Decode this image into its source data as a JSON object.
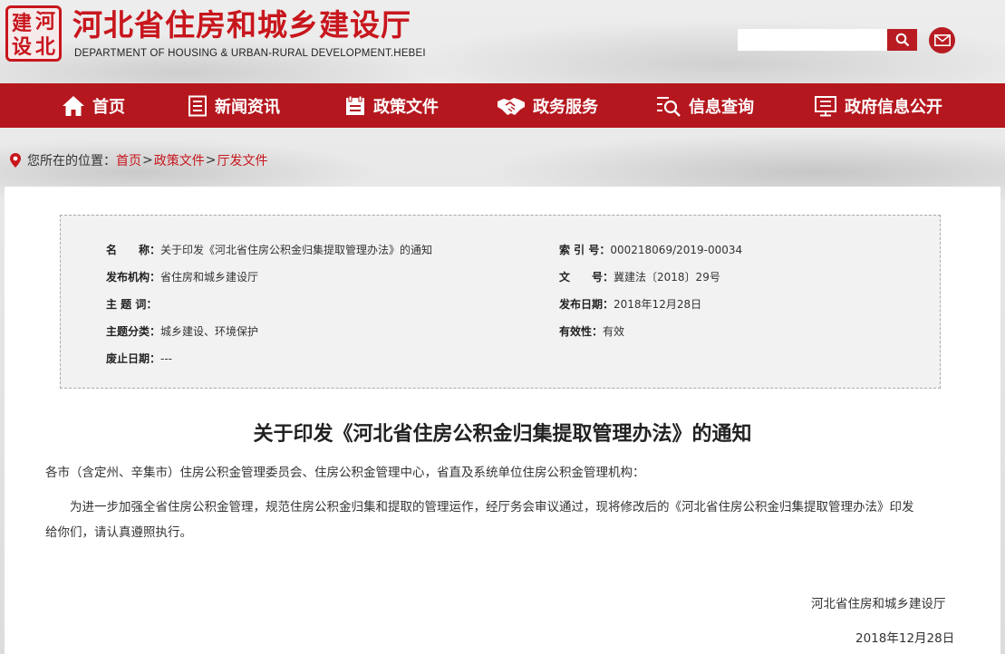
{
  "header": {
    "logo_text": "建河",
    "title": "河北省住房和城乡建设厅",
    "subtitle": "DEPARTMENT OF HOUSING & URBAN-RURAL DEVELOPMENT.HEBEI",
    "search_placeholder": "",
    "search_icon": "search-icon",
    "mail_icon": "mail-icon"
  },
  "nav": {
    "items": [
      {
        "label": "首页",
        "icon": "home-icon"
      },
      {
        "label": "新闻资讯",
        "icon": "news-icon"
      },
      {
        "label": "政策文件",
        "icon": "document-icon"
      },
      {
        "label": "政务服务",
        "icon": "handshake-icon"
      },
      {
        "label": "信息查询",
        "icon": "search-list-icon"
      },
      {
        "label": "政府信息公开",
        "icon": "disclosure-icon"
      }
    ]
  },
  "breadcrumb": {
    "prefix": "您所在的位置：",
    "items": [
      "首页",
      "政策文件",
      "厅发文件"
    ],
    "separator": ">"
  },
  "meta": {
    "name_label": "名　　称：",
    "name_value": "关于印发《河北省住房公积金归集提取管理办法》的通知",
    "index_label": "索 引 号：",
    "index_value": "000218069/2019-00034",
    "issuer_label": "发布机构：",
    "issuer_value": "省住房和城乡建设厅",
    "docno_label": "文　　号：",
    "docno_value": "冀建法〔2018〕29号",
    "keywords_label": "主 题 词：",
    "keywords_value": "",
    "date_label": "发布日期：",
    "date_value": "2018年12月28日",
    "category_label": "主题分类：",
    "category_value": "城乡建设、环境保护",
    "validity_label": "有效性：",
    "validity_value": "有效",
    "expiry_label": "废止日期：",
    "expiry_value": "---"
  },
  "document": {
    "title": "关于印发《河北省住房公积金归集提取管理办法》的通知",
    "addressee": "各市（含定州、辛集市）住房公积金管理委员会、住房公积金管理中心，省直及系统单位住房公积金管理机构：",
    "body_line1": "为进一步加强全省住房公积金管理，规范住房公积金归集和提取的管理运作，经厅务会审议通过，现将修改后的《河北省住房公积金归集提取管理办法》印发",
    "body_line2": "给你们，请认真遵照执行。",
    "signature": "河北省住房和城乡建设厅",
    "date": "2018年12月28日"
  },
  "colors": {
    "brand_red": "#b5171e",
    "title_red": "#c8161d",
    "meta_bg": "#f2f2f2"
  }
}
